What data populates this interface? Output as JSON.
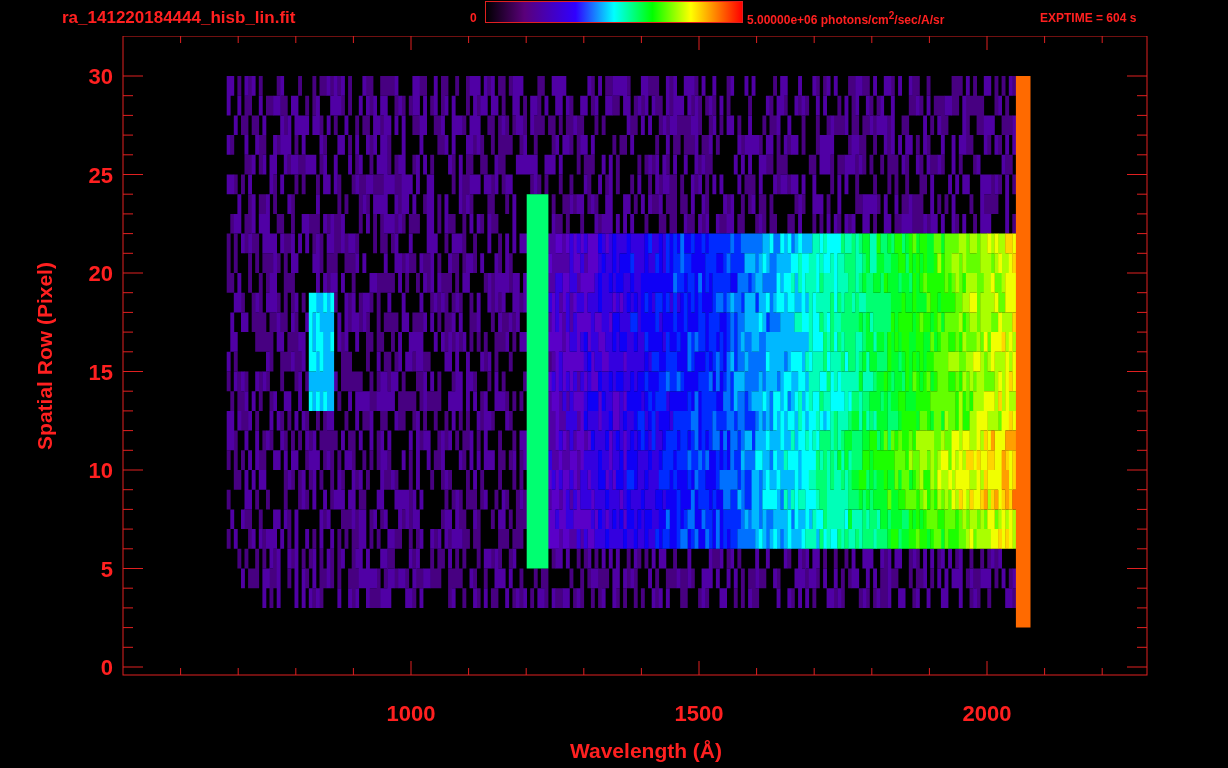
{
  "title": "ra_141220184444_hisb_lin.fit",
  "colorbar": {
    "min_label": "0",
    "max_label": "5.00000e+06 photons/cm$^{2}$/sec/A/sr"
  },
  "exptime": "EXPTIME = 604 s",
  "y_axis": {
    "label": "Spatial Row (Pixel)",
    "ticks": [
      "30",
      "25",
      "20",
      "15",
      "10",
      "5",
      "0"
    ]
  },
  "x_axis": {
    "label": "Wavelength (Å)",
    "ticks": [
      "1000",
      "1500",
      "2000"
    ]
  }
}
